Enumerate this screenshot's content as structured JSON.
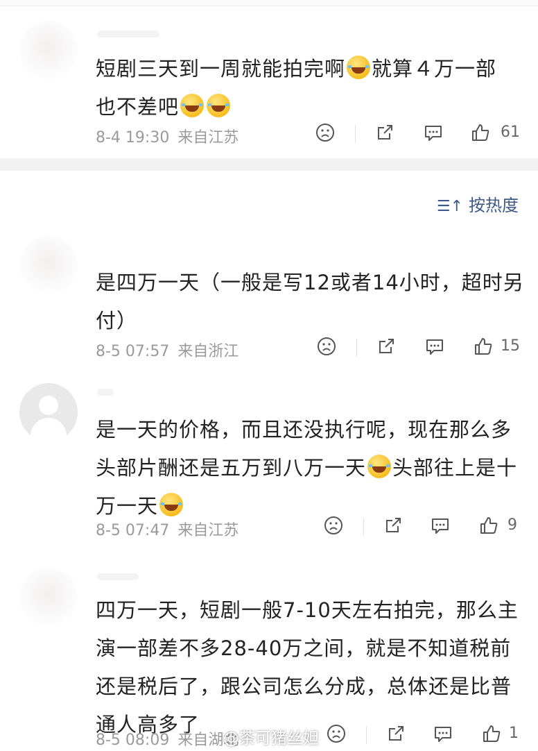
{
  "sort_label": "按热度",
  "watermark": "@茶可猪丝妲",
  "comments": [
    {
      "text_parts": [
        "短剧三天到一周就能拍完啊",
        "就算４万一部\n也不差吧",
        ""
      ],
      "time": "8-4 19:30",
      "location": "来自江苏",
      "likes": "61"
    },
    {
      "text": "是四万一天（一般是写12或者14小时，超时另\n付）",
      "time": "8-5 07:57",
      "location": "来自浙江",
      "likes": "15"
    },
    {
      "text_parts": [
        "是一天的价格，而且还没执行呢，现在那么多\n头部片酬还是五万到八万一天",
        "头部往上是十\n万一天",
        ""
      ],
      "time": "8-5 07:47",
      "location": "来自江苏",
      "likes": "9"
    },
    {
      "text": "四万一天，短剧一般7-10天左右拍完，那么主\n演一部差不多28-40万之间，就是不知道税前\n还是税后了，跟公司怎么分成，总体还是比普\n通人高多了",
      "time": "8-5 08:09",
      "location": "来自湖北",
      "likes": "1"
    }
  ],
  "icons": {
    "emoji": "laugh-cry-emoji",
    "dislike": "frown-face-icon",
    "share": "share-icon",
    "comment": "comment-bubble-icon",
    "like": "thumbs-up-icon",
    "sort": "sort-icon"
  },
  "colors": {
    "accent": "#3f5a86",
    "meta": "#9a9a9a",
    "band": "#f2f2f2"
  }
}
